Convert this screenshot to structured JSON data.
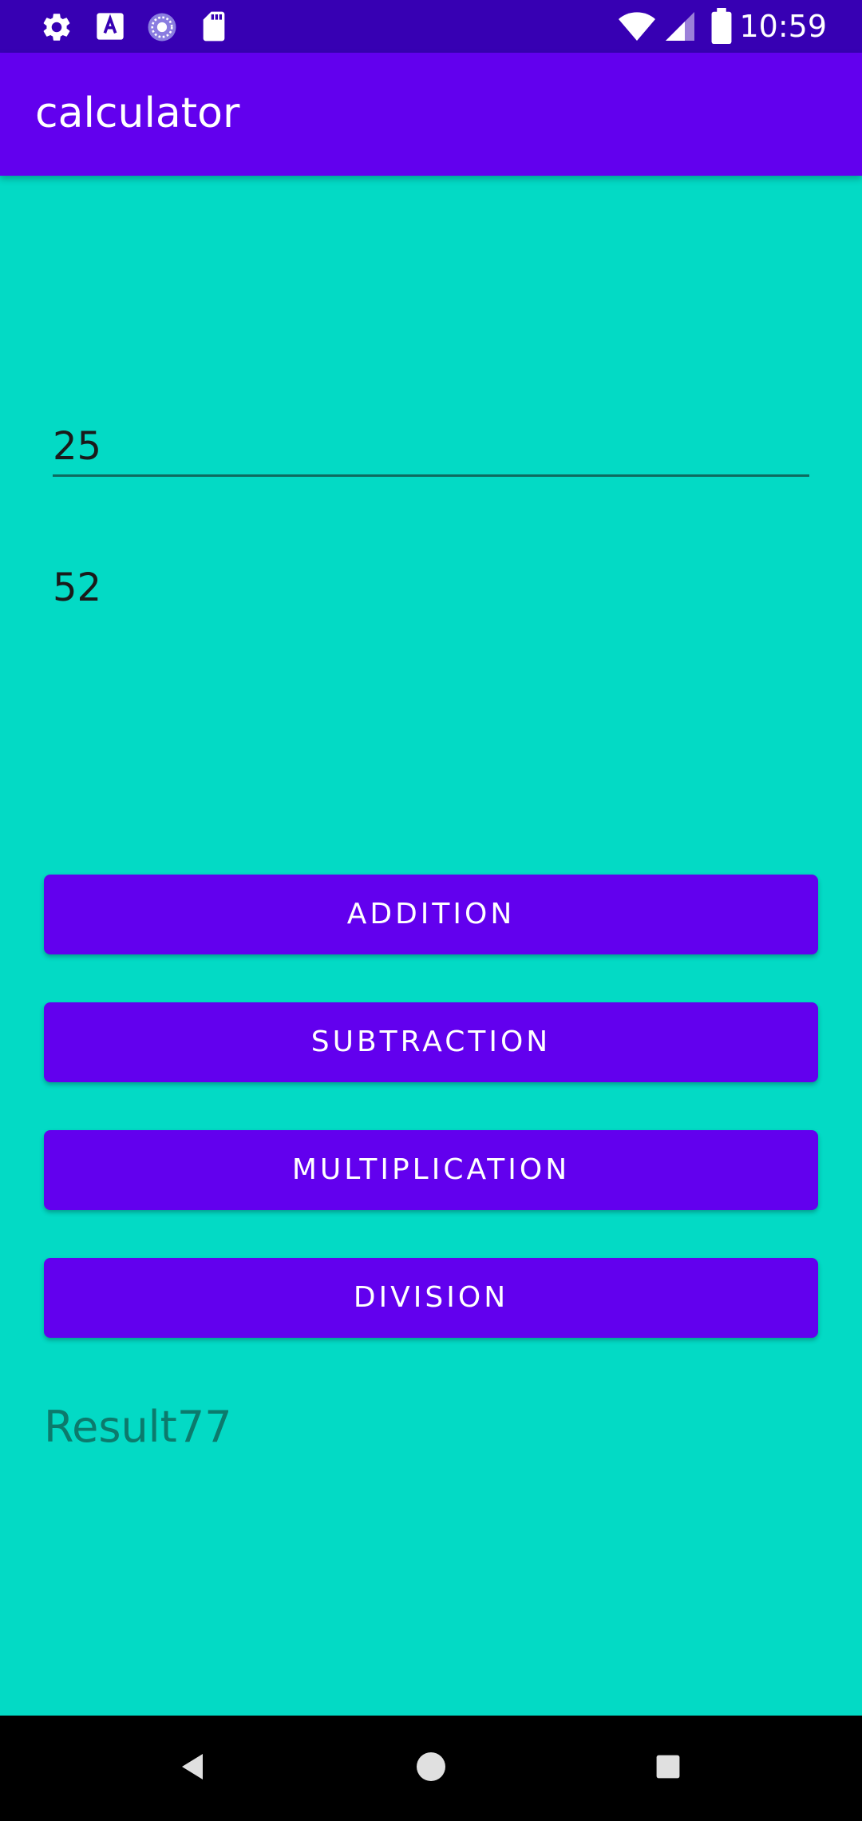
{
  "status_bar": {
    "time": "10:59",
    "icons_left": [
      "gear-icon",
      "font-a-icon",
      "sync-circle-icon",
      "sd-card-icon"
    ],
    "icons_right": [
      "wifi-icon",
      "signal-icon",
      "battery-icon"
    ]
  },
  "app_bar": {
    "title": "calculator"
  },
  "inputs": {
    "first_number": "25",
    "second_number": "52"
  },
  "buttons": {
    "addition": "ADDITION",
    "subtraction": "SUBTRACTION",
    "multiplication": "MULTIPLICATION",
    "division": "DIVISION"
  },
  "result": {
    "text": "Result77"
  },
  "nav_bar": {
    "icons": [
      "back-icon",
      "home-icon",
      "recents-icon"
    ]
  },
  "colors": {
    "status_bar": "#3700B3",
    "primary": "#6200EE",
    "background": "#03DAC5",
    "nav_bar": "#000000"
  }
}
